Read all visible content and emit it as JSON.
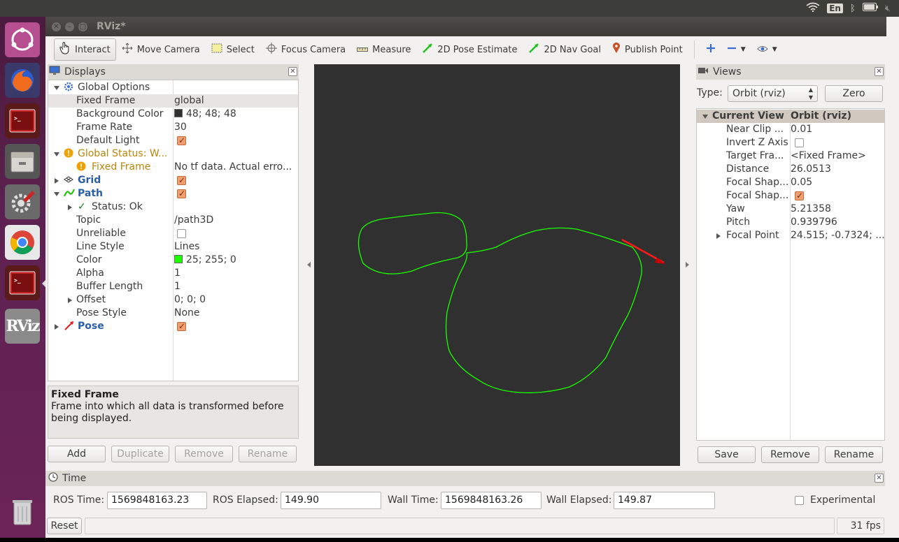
{
  "top_panel": {
    "language": "En"
  },
  "window": {
    "title": "RViz*"
  },
  "toolbar": {
    "interact": "Interact",
    "move_camera": "Move Camera",
    "select": "Select",
    "focus_camera": "Focus Camera",
    "measure": "Measure",
    "pose_estimate": "2D Pose Estimate",
    "nav_goal": "2D Nav Goal",
    "publish_point": "Publish Point"
  },
  "displays": {
    "title": "Displays",
    "rows": {
      "global_options": "Global Options",
      "fixed_frame_k": "Fixed Frame",
      "fixed_frame_v": "global",
      "bg_color_k": "Background Color",
      "bg_color_v": "48; 48; 48",
      "frame_rate_k": "Frame Rate",
      "frame_rate_v": "30",
      "default_light_k": "Default Light",
      "global_status": "Global Status: W...",
      "status_fixed_frame_k": "Fixed Frame",
      "status_fixed_frame_v": "No tf data.  Actual erro...",
      "grid": "Grid",
      "path": "Path",
      "status_ok": "Status: Ok",
      "topic_k": "Topic",
      "topic_v": "/path3D",
      "unreliable_k": "Unreliable",
      "line_style_k": "Line Style",
      "line_style_v": "Lines",
      "color_k": "Color",
      "color_v": "25; 255; 0",
      "alpha_k": "Alpha",
      "alpha_v": "1",
      "buffer_k": "Buffer Length",
      "buffer_v": "1",
      "offset_k": "Offset",
      "offset_v": "0; 0; 0",
      "pose_style_k": "Pose Style",
      "pose_style_v": "None",
      "pose": "Pose"
    },
    "description_title": "Fixed Frame",
    "description_text": "Frame into which all data is transformed before being displayed.",
    "buttons": {
      "add": "Add",
      "duplicate": "Duplicate",
      "remove": "Remove",
      "rename": "Rename"
    }
  },
  "views": {
    "title": "Views",
    "type_label": "Type:",
    "type_value": "Orbit (rviz)",
    "zero": "Zero",
    "current_view_k": "Current View",
    "current_view_v": "Orbit (rviz)",
    "props": {
      "near_clip_k": "Near Clip ...",
      "near_clip_v": "0.01",
      "invert_z_k": "Invert Z Axis",
      "target_k": "Target Fra...",
      "target_v": "<Fixed Frame>",
      "distance_k": "Distance",
      "distance_v": "26.0513",
      "focal_shape1_k": "Focal Shap...",
      "focal_shape1_v": "0.05",
      "focal_shape2_k": "Focal Shap...",
      "yaw_k": "Yaw",
      "yaw_v": "5.21358",
      "pitch_k": "Pitch",
      "pitch_v": "0.939796",
      "focal_point_k": "Focal Point",
      "focal_point_v": "24.515; -0.7324; ..."
    },
    "buttons": {
      "save": "Save",
      "remove": "Remove",
      "rename": "Rename"
    }
  },
  "time": {
    "title": "Time",
    "ros_time_label": "ROS Time:",
    "ros_time": "1569848163.23",
    "ros_elapsed_label": "ROS Elapsed:",
    "ros_elapsed": "149.90",
    "wall_time_label": "Wall Time:",
    "wall_time": "1569848163.26",
    "wall_elapsed_label": "Wall Elapsed:",
    "wall_elapsed": "149.87",
    "experimental": "Experimental"
  },
  "status": {
    "reset": "Reset",
    "fps": "31 fps"
  },
  "colors": {
    "background": "#303030",
    "path": "#19ff00",
    "pose_arrow": "#ff0000"
  }
}
